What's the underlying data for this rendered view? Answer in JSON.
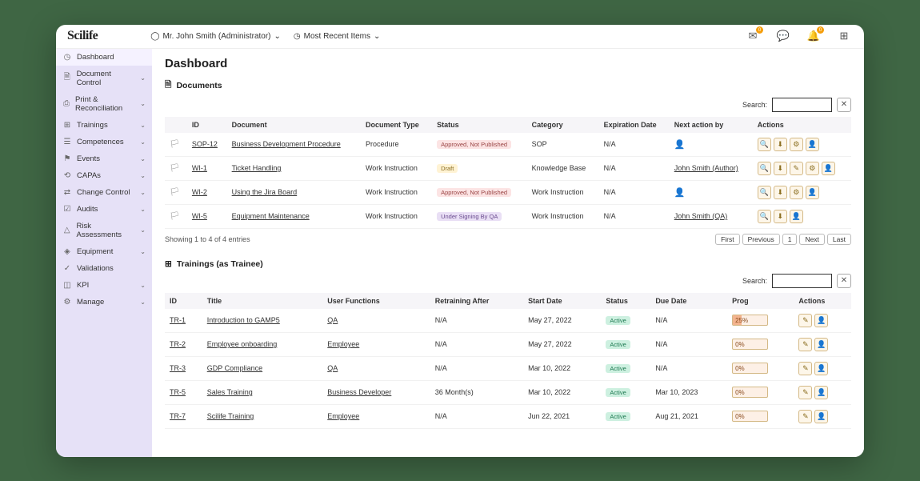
{
  "brand": "Scilife",
  "top": {
    "user": "Mr. John Smith (Administrator)",
    "recent": "Most Recent Items",
    "mail_badge": "0",
    "bell_badge": "0"
  },
  "sidebar": {
    "items": [
      {
        "label": "Dashboard",
        "icon": "◷",
        "active": true,
        "expand": false
      },
      {
        "label": "Document Control",
        "icon": "🗎",
        "expand": true
      },
      {
        "label": "Print & Reconciliation",
        "icon": "⎙",
        "expand": true
      },
      {
        "label": "Trainings",
        "icon": "⊞",
        "expand": true
      },
      {
        "label": "Competences",
        "icon": "☰",
        "expand": true
      },
      {
        "label": "Events",
        "icon": "⚑",
        "expand": true
      },
      {
        "label": "CAPAs",
        "icon": "⟲",
        "expand": true
      },
      {
        "label": "Change Control",
        "icon": "⇄",
        "expand": true
      },
      {
        "label": "Audits",
        "icon": "☑",
        "expand": true
      },
      {
        "label": "Risk Assessments",
        "icon": "△",
        "expand": true
      },
      {
        "label": "Equipment",
        "icon": "◈",
        "expand": true
      },
      {
        "label": "Validations",
        "icon": "✓",
        "expand": false
      },
      {
        "label": "KPI",
        "icon": "◫",
        "expand": true
      },
      {
        "label": "Manage",
        "icon": "⚙",
        "expand": true
      }
    ]
  },
  "page": {
    "title": "Dashboard"
  },
  "search_label": "Search:",
  "documents": {
    "title": "Documents",
    "headers": [
      "",
      "ID",
      "Document",
      "Document Type",
      "Status",
      "Category",
      "Expiration Date",
      "Next action by",
      "Actions"
    ],
    "rows": [
      {
        "id": "SOP-12",
        "doc": "Business Development Procedure",
        "type": "Procedure",
        "status": "Approved, Not Published",
        "status_cls": "approved",
        "cat": "SOP",
        "exp": "N/A",
        "next": "",
        "next_icon": true,
        "actions": [
          "search",
          "download",
          "gear",
          "user"
        ]
      },
      {
        "id": "WI-1",
        "doc": "Ticket Handling",
        "type": "Work Instruction",
        "status": "Draft",
        "status_cls": "draft",
        "cat": "Knowledge Base",
        "exp": "N/A",
        "next": "John Smith (Author)",
        "next_icon": false,
        "actions": [
          "search",
          "download",
          "edit",
          "gear",
          "user"
        ]
      },
      {
        "id": "WI-2",
        "doc": "Using the Jira Board",
        "type": "Work Instruction",
        "status": "Approved, Not Published",
        "status_cls": "approved",
        "cat": "Work Instruction",
        "exp": "N/A",
        "next": "",
        "next_icon": true,
        "actions": [
          "search",
          "download",
          "gear",
          "user"
        ]
      },
      {
        "id": "WI-5",
        "doc": "Equipment Maintenance",
        "type": "Work Instruction",
        "status": "Under Signing By QA",
        "status_cls": "signing",
        "cat": "Work Instruction",
        "exp": "N/A",
        "next": "John Smith (QA)",
        "next_icon": false,
        "actions": [
          "search",
          "download",
          "user"
        ]
      }
    ],
    "showing": "Showing 1 to 4 of 4 entries",
    "pager": [
      "First",
      "Previous",
      "1",
      "Next",
      "Last"
    ]
  },
  "trainings": {
    "title": "Trainings (as Trainee)",
    "headers": [
      "ID",
      "Title",
      "User Functions",
      "Retraining After",
      "Start Date",
      "Status",
      "Due Date",
      "Prog",
      "Actions"
    ],
    "rows": [
      {
        "id": "TR-1",
        "title": "Introduction to GAMP5",
        "func": "QA",
        "retrain": "N/A",
        "start": "May 27, 2022",
        "status": "Active",
        "due": "N/A",
        "prog": "25%",
        "prog_w": 25
      },
      {
        "id": "TR-2",
        "title": "Employee onboarding",
        "func": "Employee",
        "retrain": "N/A",
        "start": "May 27, 2022",
        "status": "Active",
        "due": "N/A",
        "prog": "0%",
        "prog_w": 0
      },
      {
        "id": "TR-3",
        "title": "GDP Compliance",
        "func": "QA",
        "retrain": "N/A",
        "start": "Mar 10, 2022",
        "status": "Active",
        "due": "N/A",
        "prog": "0%",
        "prog_w": 0
      },
      {
        "id": "TR-5",
        "title": "Sales Training",
        "func": "Business Developer",
        "retrain": "36 Month(s)",
        "start": "Mar 10, 2022",
        "status": "Active",
        "due": "Mar 10, 2023",
        "prog": "0%",
        "prog_w": 0
      },
      {
        "id": "TR-7",
        "title": "Scilife Training",
        "func": "Employee",
        "retrain": "N/A",
        "start": "Jun 22, 2021",
        "status": "Active",
        "due": "Aug 21, 2021",
        "prog": "0%",
        "prog_w": 0
      }
    ]
  },
  "action_glyphs": {
    "search": "🔍",
    "download": "⬇",
    "gear": "⚙",
    "user": "👤",
    "edit": "✎"
  }
}
